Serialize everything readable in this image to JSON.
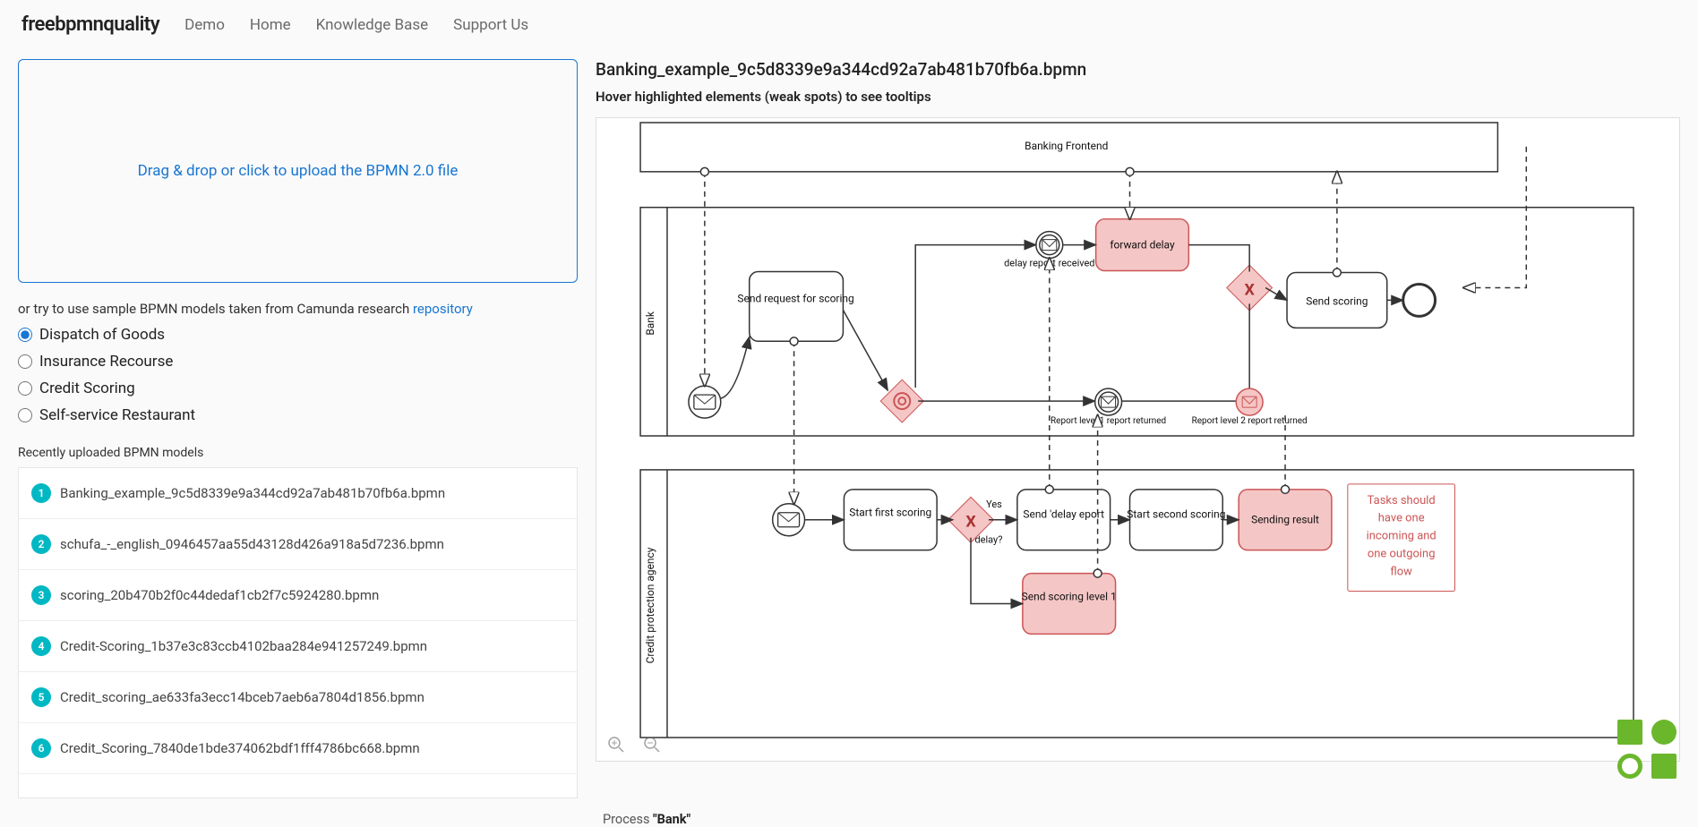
{
  "brand": "freebpmnquality",
  "nav": [
    "Demo",
    "Home",
    "Knowledge Base",
    "Support Us"
  ],
  "dropzone": "Drag & drop or click to upload the BPMN 2.0 file",
  "sample_label_pre": "or try to use sample BPMN models taken from Camunda research ",
  "sample_label_link": "repository",
  "radios": [
    {
      "label": "Dispatch of Goods",
      "checked": true
    },
    {
      "label": "Insurance Recourse",
      "checked": false
    },
    {
      "label": "Credit Scoring",
      "checked": false
    },
    {
      "label": "Self-service Restaurant",
      "checked": false
    }
  ],
  "recent_label": "Recently uploaded BPMN models",
  "recent": [
    {
      "n": "1",
      "name": "Banking_example_9c5d8339e9a344cd92a7ab481b70fb6a.bpmn"
    },
    {
      "n": "2",
      "name": "schufa_-_english_0946457aa55d43128d426a918a5d7236.bpmn"
    },
    {
      "n": "3",
      "name": "scoring_20b470b2f0c44dedaf1cb2f7c5924280.bpmn"
    },
    {
      "n": "4",
      "name": "Credit-Scoring_1b37e3c83ccb4102baa284e941257249.bpmn"
    },
    {
      "n": "5",
      "name": "Credit_scoring_ae633fa3ecc14bceb7aeb6a7804d1856.bpmn"
    },
    {
      "n": "6",
      "name": "Credit_Scoring_7840de1bde374062bdf1fff4786bc668.bpmn"
    }
  ],
  "filename": "Banking_example_9c5d8339e9a344cd92a7ab481b70fb6a.bpmn",
  "hint": "Hover highlighted elements (weak spots) to see tooltips",
  "pools": {
    "frontend": "Banking Frontend",
    "bank": "Bank",
    "agency": "Credit protection agency"
  },
  "tasks": {
    "send_request": "Send request for scoring",
    "forward_delay": "forward delay",
    "send_scoring": "Send scoring",
    "start_first": "Start first scoring",
    "send_delay_eport": "Send 'delay eport",
    "start_second": "Start second scoring",
    "sending_result": "Sending result",
    "send_scoring_l1": "Send scoring level 1"
  },
  "events": {
    "delay_report_received": "delay report received",
    "report_level1": "Report level 1 report returned",
    "report_level2": "Report level 2 report returned"
  },
  "gateway_labels": {
    "yes": "Yes",
    "delay": "delay?"
  },
  "tooltip": "Tasks should have one incoming and one outgoing flow",
  "process_pre": "Process ",
  "process_name": "\"Bank\""
}
